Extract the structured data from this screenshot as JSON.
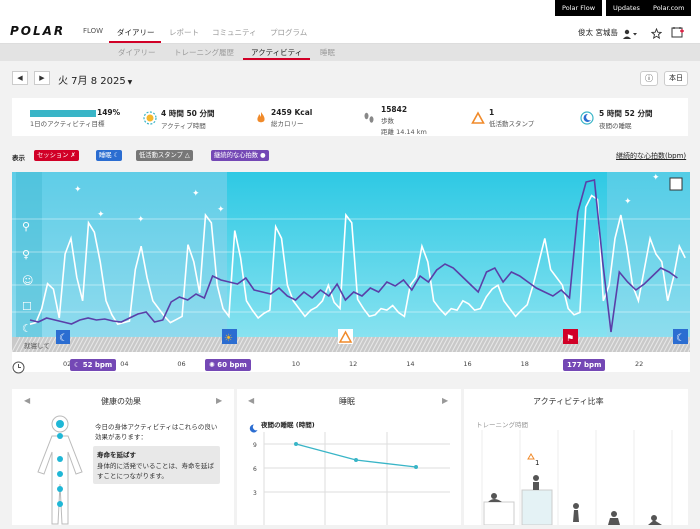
{
  "top_links": [
    "Polar Flow",
    "Updates",
    "Polar.com"
  ],
  "brand": {
    "logo": "POLAR",
    "product": "FLOW"
  },
  "nav": {
    "items": [
      "ダイアリー",
      "レポート",
      "コミュニティ",
      "プログラム"
    ],
    "user_name": "俊太 宮城島"
  },
  "subnav": {
    "items": [
      "ダイアリー",
      "トレーニング履歴",
      "アクティビティ",
      "睡眠"
    ]
  },
  "datebar": {
    "prev": "◀",
    "next": "▶",
    "date": "火 7月 8 2025",
    "info": "ⓘ",
    "today": "本日"
  },
  "summary": [
    {
      "value": "149%",
      "label": "1日のアクティビティ目標",
      "progress": 1.0
    },
    {
      "value": "4 時間 50 分間",
      "label": "アクティブ時間"
    },
    {
      "value": "2459 Kcal",
      "label": "総カロリー"
    },
    {
      "value": "15842",
      "label": "歩数",
      "extra": "距離 14.14 km"
    },
    {
      "value": "1",
      "label": "低活動スタンプ"
    },
    {
      "value": "5 時間 52 分間",
      "label": "夜間の睡眠"
    }
  ],
  "display": {
    "label": "表示",
    "tags": [
      "セッション",
      "睡眠",
      "低活動スタンプ",
      "継続的な心拍数"
    ],
    "right_link": "継続的な心拍数(bpm)"
  },
  "chart_data": {
    "type": "line",
    "x_ticks": [
      "02",
      "04",
      "06",
      "08",
      "10",
      "12",
      "14",
      "16",
      "18",
      "20",
      "22"
    ],
    "markers": [
      {
        "label": "52 bpm"
      },
      {
        "label": "60 bpm"
      },
      {
        "label": "177 bpm"
      }
    ],
    "y_icons": [
      "run-icon",
      "walk-icon",
      "stand-icon",
      "sit-icon",
      "sleep-icon"
    ],
    "sleep_label": "就寝して"
  },
  "panels": [
    {
      "title": "健康の効果",
      "text": "今日の身体アクティビティはこれらの良い効果があります：",
      "box_title": "寿命を延ばす",
      "box_text": "身体的に活発でいることは、寿命を延ばすことにつながります。"
    },
    {
      "title": "睡眠",
      "sub": "夜間の睡眠 (時間)",
      "y_ticks": [
        "9",
        "6",
        "3"
      ]
    },
    {
      "title": "アクティビティ比率",
      "sub": "トレーニング時間",
      "badge": "1"
    }
  ],
  "colors": {
    "brand_red": "#d10027",
    "purple": "#7448b5",
    "cyan": "#2ec9e4"
  }
}
